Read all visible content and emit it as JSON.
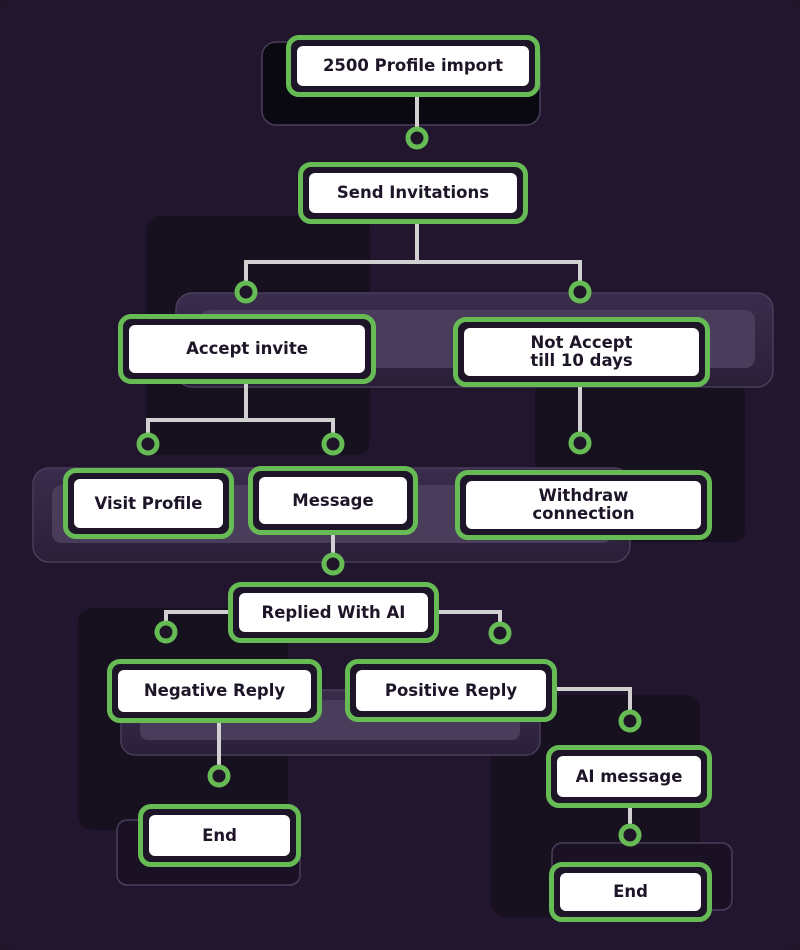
{
  "colors": {
    "background": "#21162d",
    "node_border": "#66bb55",
    "node_fill": "#ffffff",
    "connector": "#d0d0d0",
    "panel": "#4a3d5c"
  },
  "nodes": {
    "profile_import": "2500 Profile import",
    "send_invitations": "Send Invitations",
    "accept_invite": "Accept invite",
    "not_accept": "Not Accept till 10 days",
    "visit_profile": "Visit Profile",
    "message": "Message",
    "withdraw": "Withdraw connection",
    "replied_ai": "Replied With AI",
    "negative_reply": "Negative Reply",
    "positive_reply": "Positive Reply",
    "ai_message": "AI message",
    "end_left": "End",
    "end_right": "End"
  }
}
